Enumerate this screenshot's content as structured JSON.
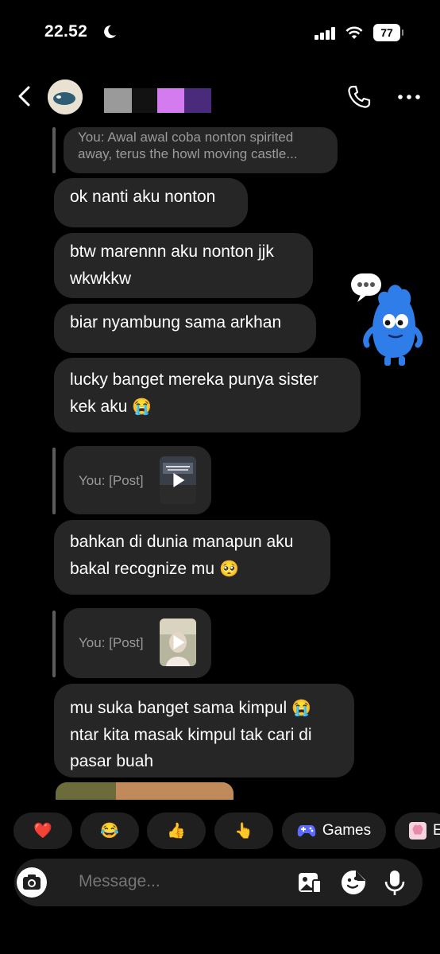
{
  "status_bar": {
    "time": "22.52",
    "battery": "77"
  },
  "header": {
    "contact_name": ""
  },
  "messages": {
    "reply1": "You: Awal awal coba nonton spirited away, terus the howl moving castle...",
    "m1": "ok nanti aku nonton",
    "m2a": "btw marennn aku nonton jjk",
    "m2b": "wkwkkw",
    "m3": "biar nyambung sama arkhan",
    "m4a": "lucky banget mereka punya sister",
    "m4b": "kek aku",
    "reply2": "You: [Post]",
    "m5a": "bahkan di dunia manapun aku",
    "m5b": "bakal recognize mu",
    "reply3": "You: [Post]",
    "m6a": "mu suka banget sama kimpul",
    "m6b": "ntar kita masak kimpul tak cari di",
    "m6c": "pasar buah"
  },
  "emojis": {
    "crying": "😭",
    "pleading": "🥺"
  },
  "quick_reactions": {
    "heart": "❤️",
    "laugh": "😂",
    "thumbs_up": "👍",
    "point": "👆",
    "games_label": "Games",
    "partial_label": "E"
  },
  "composer": {
    "placeholder": "Message..."
  },
  "icons": [
    "back-icon",
    "phone-icon",
    "more-icon",
    "play-icon",
    "camera-icon",
    "gallery-icon",
    "sticker-icon",
    "microphone-icon",
    "gamepad-icon",
    "brain-icon"
  ],
  "colors": {
    "background": "#000000",
    "bubble": "#262626",
    "chip": "#1f1f1f",
    "accent_purple": "#d57bf0"
  }
}
